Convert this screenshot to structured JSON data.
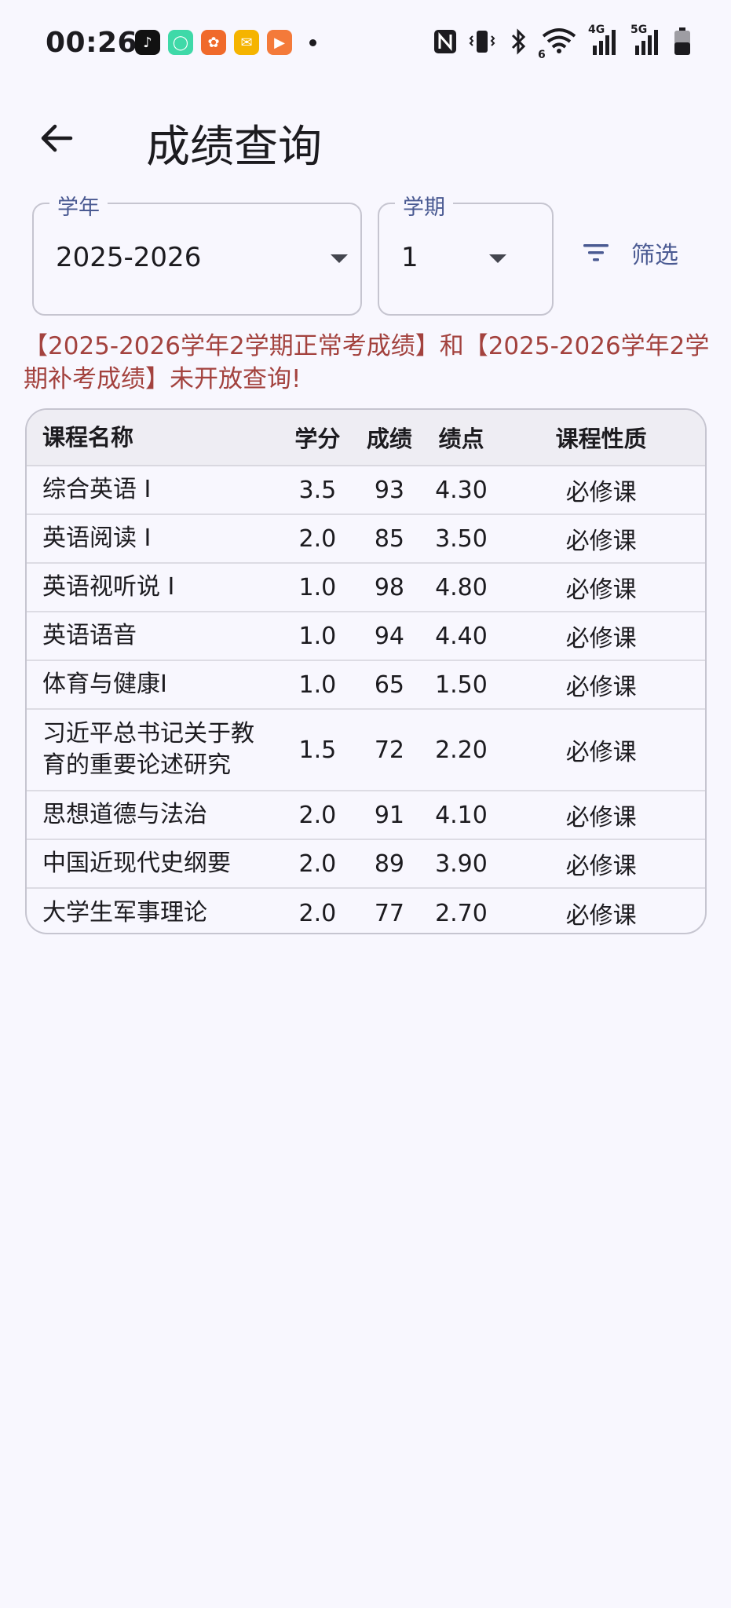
{
  "status": {
    "time": "00:26",
    "network_4g": "4G",
    "network_5g": "5G",
    "wifi_sub": "6"
  },
  "header": {
    "title": "成绩查询"
  },
  "filters": {
    "year_label": "学年",
    "year_value": "2025-2026",
    "term_label": "学期",
    "term_value": "1",
    "filter_label": "筛选"
  },
  "notice": "【2025-2026学年2学期正常考成绩】和【2025-2026学年2学期补考成绩】未开放查询!",
  "table": {
    "headers": [
      "课程名称",
      "学分",
      "成绩",
      "绩点",
      "课程性质"
    ],
    "rows": [
      [
        "综合英语 I",
        "3.5",
        "93",
        "4.30",
        "必修课"
      ],
      [
        "英语阅读 I",
        "2.0",
        "85",
        "3.50",
        "必修课"
      ],
      [
        "英语视听说 I",
        "1.0",
        "98",
        "4.80",
        "必修课"
      ],
      [
        "英语语音",
        "1.0",
        "94",
        "4.40",
        "必修课"
      ],
      [
        "体育与健康I",
        "1.0",
        "65",
        "1.50",
        "必修课"
      ],
      [
        "习近平总书记关于教育的重要论述研究",
        "1.5",
        "72",
        "2.20",
        "必修课"
      ],
      [
        "思想道德与法治",
        "2.0",
        "91",
        "4.10",
        "必修课"
      ],
      [
        "中国近现代史纲要",
        "2.0",
        "89",
        "3.90",
        "必修课"
      ],
      [
        "大学生军事理论",
        "2.0",
        "77",
        "2.70",
        "必修课"
      ]
    ]
  },
  "colors": {
    "accent": "#4a5a92",
    "notice": "#a3423e",
    "background": "#f8f7fe"
  }
}
